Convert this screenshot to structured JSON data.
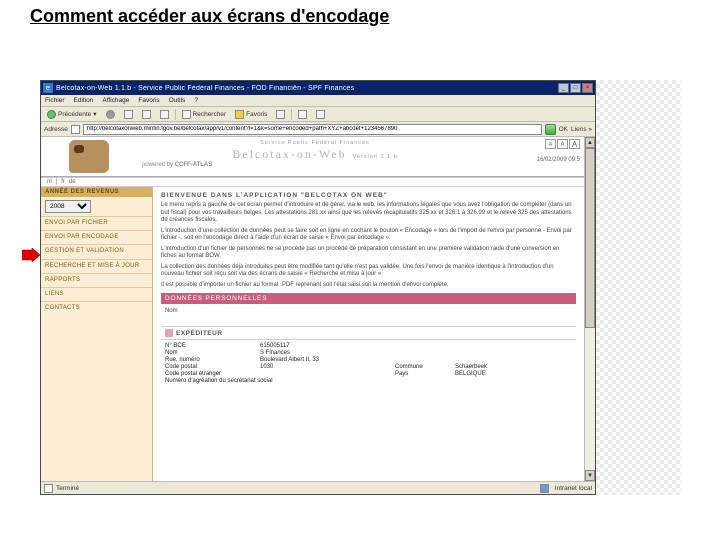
{
  "slide_title": "Comment accéder aux écrans d'encodage",
  "titlebar": {
    "text": "Belcotax-on-Web 1.1.b - Service Public Fédéral Finances - FOD Financiën - SPF Finances",
    "min": "_",
    "max": "□",
    "close": "×"
  },
  "menubar": [
    "Fichier",
    "Edition",
    "Affichage",
    "Favoris",
    "Outils",
    "?"
  ],
  "toolbar": {
    "back": "Précédente",
    "search": "Rechercher",
    "fav": "Favoris"
  },
  "address": {
    "label": "Adresse",
    "url": "http://belcotaxonweb.minfin.fgov.be/belcotax/app/v1/content?l=1&k=some+encoded+path+XYZ+abcdef+1234567890",
    "go": "OK",
    "links": "Liens »"
  },
  "banner": {
    "svc": "Service Public Fédéral Finances",
    "atlas_pre": "powered by",
    "atlas": "CCFF-ATLAS",
    "app": "Belcotax-on-Web",
    "ver": "Version 1.1.b",
    "font_s": "A",
    "font_m": "A",
    "font_l": "A",
    "date": "16/02/2009  09:5"
  },
  "langs": {
    "nl": "nl",
    "sep": "|",
    "fr": "fr",
    "de": "de",
    "right": ""
  },
  "sidebar": {
    "cap": "ANNÉE DES REVENUS",
    "year": "2008",
    "items": [
      "ENVOI PAR FICHIER",
      "ENVOI PAR ENCODAGE",
      "GESTION ET VALIDATION",
      "RECHERCHE ET MISE À JOUR",
      "RAPPORTS",
      "LIENS",
      "CONTACTS"
    ]
  },
  "doc": {
    "h": "BIENVENUE DANS L'APPLICATION \"BELCOTAX ON WEB\"",
    "p1": "Le menu repris à gauche de cet écran permet d'introduire et de gérer, via le web, les informations légales que vous avez l'obligation de compléter (dans un but fiscal) pour vos travailleurs belges. Les attestations 281.xx ainsi que les relevés récapitulatifs 325.xx et 326.1 à 326.99 et le relevé 325 des attestations de créances fiscales.",
    "p2": "L'introduction d'une collection de données peut se faire soit en ligne en cochant le bouton « Encodage » lors de l'import de l'envoi par personne - Envoi par fichier -, soit en l'encodage direct à l'aide d'un écran de saisie « Envoi par encodage ».",
    "p3": "L'introduction d'un fichier de personnes ne se procède pas un procédé de préparation consistant en une première validation raide d'une conversion en fiches au format BOW.",
    "p4": "La collection des données déjà introduites peut être modifiée tant qu'elle n'est pas validée. Une fois l'envoi de manière identique à l'introduction d'un nouveau fichier soit reçu soit via des écrans de saisie « Recherche et mise à jour ».",
    "p5": "Il est possible d'importer un fichier au format .PDF reprenant soit l'état saisi soit la mention d'envoi complète.",
    "pink": "DONNÉES PERSONNELLES",
    "nom_label": "Nom",
    "exp": "EXPÉDITEUR",
    "fields": [
      {
        "lab": "N° BCE",
        "val": "615005117"
      },
      {
        "lab": "Nom",
        "val": "S Finances"
      },
      {
        "lab": "Rue, numéro",
        "val": "Boulevard Albert II, 33"
      },
      {
        "lab": "Code postal",
        "val": "1030",
        "lab2": "Commune",
        "val2": "Schaerbeek"
      },
      {
        "lab": "Code postal étranger",
        "val": "",
        "lab2": "Pays",
        "val2": "BELGIQUE"
      },
      {
        "lab": "Numéro d'agréation du secrétariat social",
        "val": ""
      }
    ]
  },
  "status": {
    "left": "Terminé",
    "right": "Intranet local"
  }
}
